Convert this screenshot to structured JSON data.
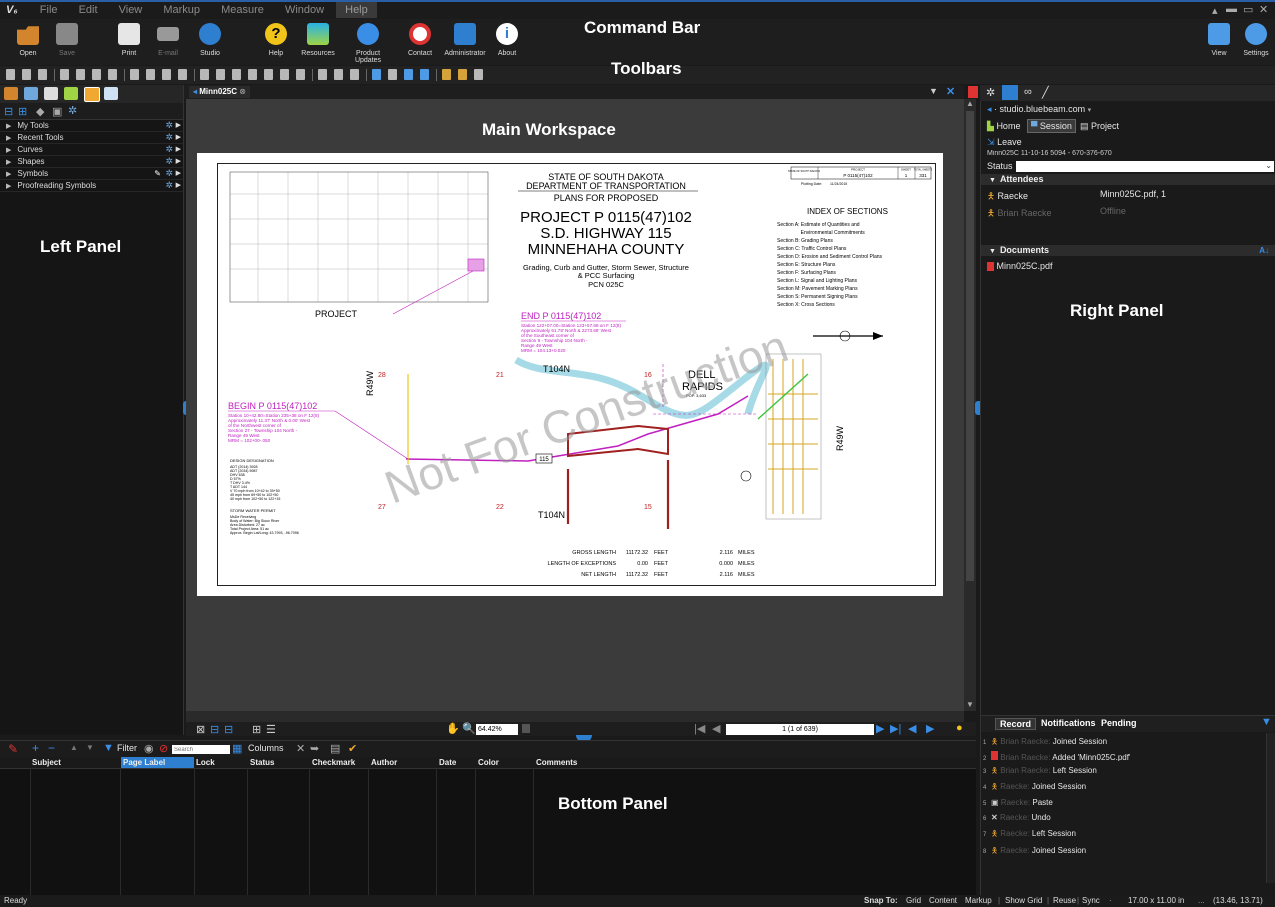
{
  "app": {
    "logo": "V₆"
  },
  "menu": [
    "File",
    "Edit",
    "View",
    "Markup",
    "Measure",
    "Window",
    "Help"
  ],
  "ribbon": {
    "buttons": [
      {
        "label": "Open",
        "icon": "folder-open-icon"
      },
      {
        "label": "Save",
        "icon": "save-icon"
      },
      {
        "label": "Print",
        "icon": "printer-icon"
      },
      {
        "label": "E-mail",
        "icon": "envelope-icon"
      },
      {
        "label": "Studio",
        "icon": "studio-icon"
      },
      {
        "label": "Help",
        "icon": "help-icon"
      },
      {
        "label": "Resources",
        "icon": "resources-icon"
      },
      {
        "label": "Product Updates",
        "icon": "updates-icon"
      },
      {
        "label": "Contact",
        "icon": "lifebuoy-icon"
      },
      {
        "label": "Administrator",
        "icon": "admin-icon"
      },
      {
        "label": "About",
        "icon": "info-icon"
      }
    ],
    "right_buttons": [
      {
        "label": "View",
        "icon": "monitor-icon"
      },
      {
        "label": "Settings",
        "icon": "settings-icon"
      }
    ]
  },
  "overlay_labels": {
    "command_bar": "Command Bar",
    "toolbars": "Toolbars",
    "main_workspace": "Main Workspace",
    "left_panel": "Left Panel",
    "right_panel": "Right Panel",
    "bottom_panel": "Bottom Panel"
  },
  "left_panel": {
    "items": [
      "My Tools",
      "Recent Tools",
      "Curves",
      "Shapes",
      "Symbols",
      "Proofreading Symbols"
    ]
  },
  "document_tab": {
    "name": "Minn025C"
  },
  "drawing": {
    "state": "STATE OF SOUTH DAKOTA",
    "department": "DEPARTMENT OF TRANSPORTATION",
    "plans_for": "PLANS FOR PROPOSED",
    "project": "PROJECT P 0115(47)102",
    "highway": "S.D. HIGHWAY 115",
    "county": "MINNEHAHA COUNTY",
    "desc1": "Grading, Curb and Gutter, Storm Sewer, Structure",
    "desc2": "& PCC Surfacing",
    "pcn": "PCN 025C",
    "title_block": {
      "state_label": "STATE OF SOUTH DAKOTA",
      "project_label": "PROJECT",
      "project": "P 0115(47)102",
      "sheet_label": "SHEET",
      "sheet": "1",
      "total_label": "TOTAL SHEETS",
      "total": "331",
      "plotting": "Plotting Date:",
      "plotting_date": "11/24/2015"
    },
    "project_map_label": "PROJECT",
    "index_title": "INDEX OF SECTIONS",
    "index": [
      "Section A:  Estimate of Quantities and",
      "                 Environmental Commitments",
      "Section B:  Grading Plans",
      "Section C:  Traffic Control Plans",
      "Section D:  Erosion and Sediment Control Plans",
      "Section E:  Structure Plans",
      "Section F:  Surfacing Plans",
      "Section L:  Signal and Lighting Plans",
      "Section M:  Pavement Marking Plans",
      "Section S:  Permanent Signing Plans",
      "Section X:  Cross Sections"
    ],
    "end_title": "END P 0115(47)102",
    "end_lines": [
      "Station 122+07.00=Station 123+57.68 on F 12(8)",
      "Approximately 61.78' North & 2273.68' West",
      "of the Southeast corner of",
      "Section 9 - Township 104 North -",
      "Range 49 West",
      "MRM = 104.13+0.020"
    ],
    "begin_title": "BEGIN P 0115(47)102",
    "begin_lines": [
      "Station 10+42.80=Station 235+38 on F 12(8)",
      "Approximately 11.37' North & 0.00' West",
      "of the Northwest corner of",
      "Section 27 - Township 104 North -",
      "Range 49 West",
      "MRM = 102+00-.050"
    ],
    "watermark": "Not For Construction",
    "city": [
      "DELL",
      "RAPIDS"
    ],
    "pop": "POP. 3,633",
    "township_top": "T104N",
    "township_bottom": "T104N",
    "range_left": "R49W",
    "range_right": "R49W",
    "route": "115",
    "sections": [
      "28",
      "21",
      "16",
      "27",
      "22",
      "15"
    ],
    "design_title": "DESIGN DESIGNATION",
    "design_lines": [
      "ADT (2014)        3928",
      "ADT (2034)        5987",
      "DHV                  638",
      "D                       57%",
      "T DHV               3.4%",
      "T ADT                144",
      "V     70 mph from 10+42 to 39+50",
      "      45 mph from 69+50 to 102+50",
      "      40 mph from 102+50 to 122+15"
    ],
    "storm_title": "STORM WATER PERMIT",
    "storm_lines": [
      "MsDe Receiving",
      "Body of Water: Big Sioux River",
      "Area Disturbed: 27 ac",
      "Total Project Area: 51 ac",
      "Approx. Begin Lat/Long: 43.7993, -96.7096"
    ],
    "lengths": [
      {
        "label": "GROSS LENGTH",
        "feet": "11172.32",
        "unit": "FEET",
        "miles": "2.116",
        "munit": "MILES"
      },
      {
        "label": "LENGTH OF EXCEPTIONS",
        "feet": "0.00",
        "unit": "FEET",
        "miles": "0.000",
        "munit": "MILES"
      },
      {
        "label": "NET LENGTH",
        "feet": "11172.32",
        "unit": "FEET",
        "miles": "2.116",
        "munit": "MILES"
      }
    ]
  },
  "navigation": {
    "zoom": "64.42%",
    "page": "1 (1 of 639)"
  },
  "right_panel": {
    "server": "studio.bluebeam.com",
    "tabs": [
      "Home",
      "Session",
      "Project"
    ],
    "leave": "Leave",
    "session_id": "Minn025C 11-10-16 5094 - 670-376-670",
    "status_label": "Status",
    "attendees_title": "Attendees",
    "attendees": [
      {
        "name": "Raecke",
        "detail": "Minn025C.pdf, 1",
        "online": true
      },
      {
        "name": "Brian Raecke",
        "detail": "Offline",
        "online": false
      }
    ],
    "documents_title": "Documents",
    "documents": [
      "Minn025C.pdf"
    ],
    "record_tabs": [
      "Record",
      "Notifications",
      "Pending"
    ],
    "records": [
      {
        "n": "1",
        "icon": "person-icon",
        "user": "Brian Raecke:",
        "action": "Joined Session"
      },
      {
        "n": "2",
        "icon": "pdf-icon",
        "user": "Brian Raecke:",
        "action": "Added 'Minn025C.pdf'"
      },
      {
        "n": "3",
        "icon": "person-icon",
        "user": "Brian Raecke:",
        "action": "Left Session"
      },
      {
        "n": "4",
        "icon": "person-icon",
        "user": "Raecke:",
        "action": "Joined Session"
      },
      {
        "n": "5",
        "icon": "paste-icon",
        "user": "Raecke:",
        "action": "Paste"
      },
      {
        "n": "6",
        "icon": "undo-x-icon",
        "user": "Raecke:",
        "action": "Undo"
      },
      {
        "n": "7",
        "icon": "person-icon",
        "user": "Raecke:",
        "action": "Left Session"
      },
      {
        "n": "8",
        "icon": "person-icon",
        "user": "Raecke:",
        "action": "Joined Session"
      }
    ]
  },
  "bottom_panel": {
    "filter": "Filter",
    "search_placeholder": "Search",
    "columns": "Columns",
    "headers": [
      "Subject",
      "Page Label",
      "Lock",
      "Status",
      "Checkmark",
      "Author",
      "Date",
      "Color",
      "Comments"
    ]
  },
  "status_bar": {
    "left": "Ready",
    "snap_label": "Snap To:",
    "snap_items": [
      "Grid",
      "Content",
      "Markup",
      "Show Grid",
      "Reuse",
      "Sync"
    ],
    "size": "17.00 x 11.00 in",
    "coords": "(13.46, 13.71)"
  },
  "colors": {
    "accent": "#2e7fd0",
    "magenta": "#c020c0",
    "workspace": "#3b3b3b"
  }
}
